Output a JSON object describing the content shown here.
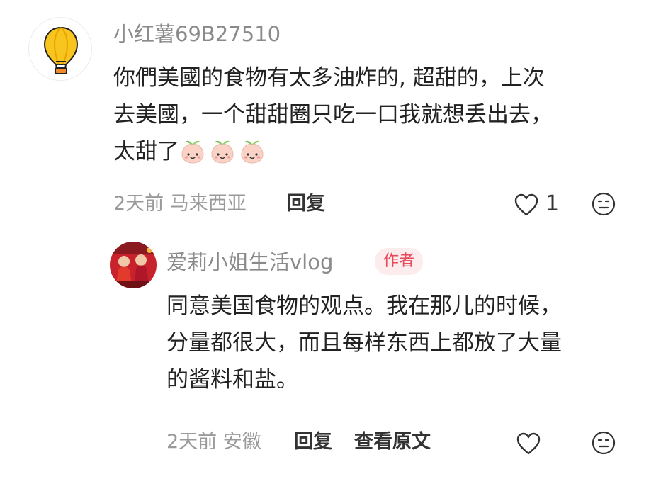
{
  "comment": {
    "username": "小红薯69B27510",
    "lines": [
      "你們美國的食物有太多油炸的, 超甜的，上次",
      "去美國，一个甜甜圈只吃一口我就想丢出去，",
      "太甜了"
    ],
    "emoji_count": 3,
    "time": "2天前",
    "location": "马来西亚",
    "reply_label": "回复",
    "like_count": "1"
  },
  "reply": {
    "username": "爱莉小姐生活vlog",
    "author_badge": "作者",
    "lines": [
      "同意美国食物的观点。我在那儿的时候，",
      "分量都很大，而且每样东西上都放了大量",
      "的酱料和盐。"
    ],
    "time": "2天前",
    "location": "安徽",
    "reply_label": "回复",
    "view_original_label": "查看原文"
  },
  "colors": {
    "badge_text": "#e8495a",
    "badge_bg": "#fdecee",
    "meta": "#9a9a9a"
  },
  "icons": [
    "hot-air-balloon-avatar-icon",
    "peach-emoji-icon",
    "heart-outline-icon",
    "meh-face-icon"
  ]
}
